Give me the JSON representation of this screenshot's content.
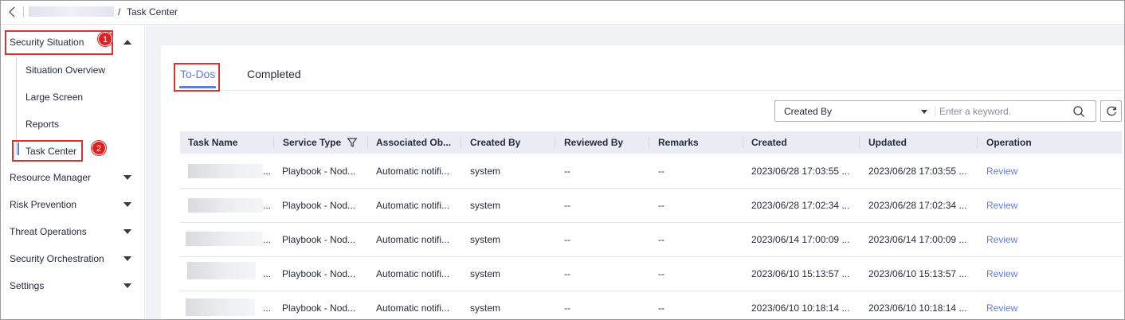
{
  "breadcrumb": {
    "separator": "/",
    "current": "Task Center"
  },
  "sidebar": {
    "groups": [
      {
        "label": "Security Situation",
        "expanded": true
      },
      {
        "label": "Resource Manager",
        "expanded": false
      },
      {
        "label": "Risk Prevention",
        "expanded": false
      },
      {
        "label": "Threat Operations",
        "expanded": false
      },
      {
        "label": "Security Orchestration",
        "expanded": false
      },
      {
        "label": "Settings",
        "expanded": false
      }
    ],
    "sub_items": [
      "Situation Overview",
      "Large Screen",
      "Reports",
      "Task Center"
    ],
    "active_sub_item": "Task Center"
  },
  "annotations": {
    "badge1": "1",
    "badge2": "2"
  },
  "tabs": [
    {
      "label": "To-Dos",
      "active": true
    },
    {
      "label": "Completed",
      "active": false
    }
  ],
  "filter": {
    "select_value": "Created By",
    "placeholder": "Enter a keyword."
  },
  "table": {
    "columns": [
      "Task Name",
      "Service Type",
      "Associated Ob...",
      "Created By",
      "Reviewed By",
      "Remarks",
      "Created",
      "Updated",
      "Operation"
    ],
    "rows": [
      {
        "name_suffix": "...",
        "service_type": "Playbook - Nod...",
        "associated": "Automatic notifi...",
        "created_by": "system",
        "reviewed_by": "--",
        "remarks": "--",
        "created": "2023/06/28 17:03:55 ...",
        "updated": "2023/06/28 17:03:55 ...",
        "operation": "Review"
      },
      {
        "name_suffix": "...",
        "service_type": "Playbook - Nod...",
        "associated": "Automatic notifi...",
        "created_by": "system",
        "reviewed_by": "--",
        "remarks": "--",
        "created": "2023/06/28 17:02:34 ...",
        "updated": "2023/06/28 17:02:34 ...",
        "operation": "Review"
      },
      {
        "name_suffix": "...",
        "service_type": "Playbook - Nod...",
        "associated": "Automatic notifi...",
        "created_by": "system",
        "reviewed_by": "--",
        "remarks": "--",
        "created": "2023/06/14 17:00:09 ...",
        "updated": "2023/06/14 17:00:09 ...",
        "operation": "Review"
      },
      {
        "name_suffix": "...",
        "service_type": "Playbook - Nod...",
        "associated": "Automatic notifi...",
        "created_by": "system",
        "reviewed_by": "--",
        "remarks": "--",
        "created": "2023/06/10 15:13:57 ...",
        "updated": "2023/06/10 15:13:57 ...",
        "operation": "Review"
      },
      {
        "name_suffix": "...",
        "service_type": "Playbook - Nod...",
        "associated": "Automatic notifi...",
        "created_by": "system",
        "reviewed_by": "--",
        "remarks": "--",
        "created": "2023/06/10 10:18:14 ...",
        "updated": "2023/06/10 10:18:14 ...",
        "operation": "Review"
      }
    ]
  },
  "colors": {
    "accent": "#5e7ce0",
    "highlight_box": "#d93434",
    "badge": "#e02020",
    "header_bg": "#e9edf3",
    "page_bg": "#f0f2f5"
  }
}
